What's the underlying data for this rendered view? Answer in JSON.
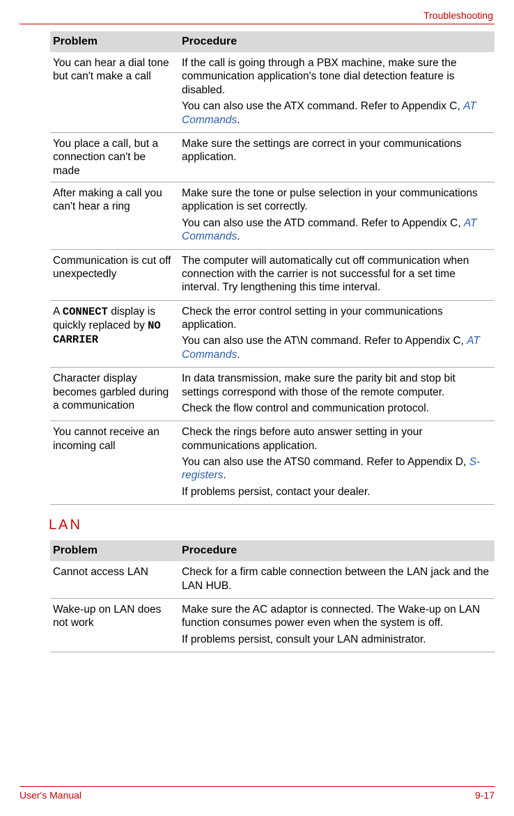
{
  "header": {
    "title": "Troubleshooting"
  },
  "table1": {
    "headers": [
      "Problem",
      "Procedure"
    ],
    "rows": [
      {
        "problem": "You can hear a dial tone but can't make a call",
        "procedure": [
          {
            "text": "If the call is going through a PBX machine, make sure the communication application's tone dial detection feature is disabled."
          },
          {
            "prefix": "You can also use the ATX command. Refer to Appendix C, ",
            "link": "AT Commands",
            "suffix": "."
          }
        ]
      },
      {
        "problem": "You place a call, but a connection can't be made",
        "procedure": [
          {
            "text": "Make sure the settings are correct in your communications application."
          }
        ]
      },
      {
        "problem": "After making a call you can't hear a ring",
        "procedure": [
          {
            "text": "Make sure the tone or pulse selection in your communications application is set correctly."
          },
          {
            "prefix": "You can also use the ATD command. Refer to Appendix C, ",
            "link": "AT Commands",
            "suffix": "."
          }
        ]
      },
      {
        "problem": "Communication is cut off unexpectedly",
        "procedure": [
          {
            "text": "The computer will automatically cut off communication when connection with the carrier is not successful for a set time interval. Try lengthening this time interval."
          }
        ]
      },
      {
        "problem_parts": {
          "p1": "A ",
          "m1": "CONNECT",
          "p2": " display is quickly replaced by ",
          "m2": "NO CARRIER"
        },
        "procedure": [
          {
            "text": "Check the error control setting in your communications application."
          },
          {
            "prefix": "You can also use the AT\\N command. Refer to Appendix C, ",
            "link": "AT Commands",
            "suffix": "."
          }
        ]
      },
      {
        "problem": "Character display becomes garbled during a communication",
        "procedure": [
          {
            "text": "In data transmission, make sure the parity bit and stop bit settings correspond with those of the remote computer."
          },
          {
            "text": "Check the flow control and communication protocol."
          }
        ]
      },
      {
        "problem": "You cannot receive an incoming call",
        "procedure": [
          {
            "text": "Check the rings before auto answer setting in your communications application."
          },
          {
            "prefix": "You can also use the ATS0 command. Refer to Appendix D, ",
            "link": "S-registers",
            "suffix": "."
          },
          {
            "text": "If problems persist, contact your dealer."
          }
        ]
      }
    ]
  },
  "section2": {
    "heading": "LAN"
  },
  "table2": {
    "headers": [
      "Problem",
      "Procedure"
    ],
    "rows": [
      {
        "problem": "Cannot access LAN",
        "procedure": [
          {
            "text": "Check for a firm cable connection between the LAN jack and the LAN HUB."
          }
        ]
      },
      {
        "problem": "Wake-up on LAN does not work",
        "procedure": [
          {
            "text": "Make sure the AC adaptor is connected. The Wake-up on LAN function consumes power even when the system is off."
          },
          {
            "text": "If problems persist, consult your LAN administrator."
          }
        ]
      }
    ]
  },
  "footer": {
    "left": "User's Manual",
    "right": "9-17"
  }
}
